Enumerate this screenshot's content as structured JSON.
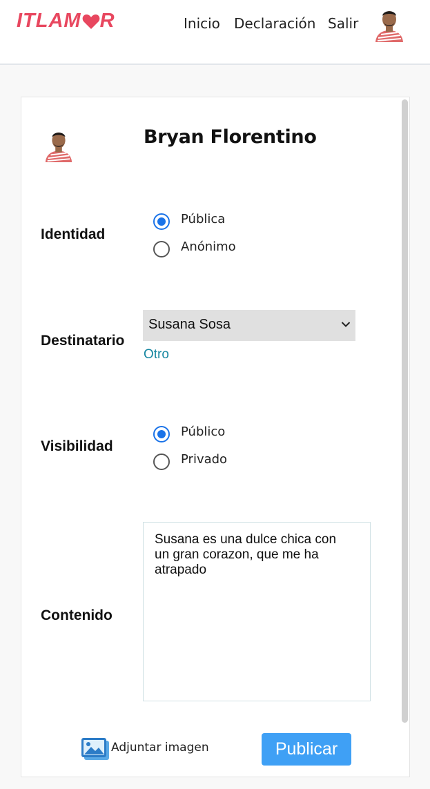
{
  "header": {
    "logo": {
      "left": "ITLAM",
      "right": "R",
      "color": "#e8475f"
    },
    "nav": [
      {
        "label": "Inicio"
      },
      {
        "label": "Declaración"
      },
      {
        "label": "Salir"
      }
    ]
  },
  "profile": {
    "name": "Bryan Florentino"
  },
  "form": {
    "identidad": {
      "label": "Identidad",
      "options": [
        {
          "label": "Pública",
          "checked": true
        },
        {
          "label": "Anónimo",
          "checked": false
        }
      ]
    },
    "destinatario": {
      "label": "Destinatario",
      "selected": "Susana Sosa",
      "other_link": "Otro"
    },
    "visibilidad": {
      "label": "Visibilidad",
      "options": [
        {
          "label": "Público",
          "checked": true
        },
        {
          "label": "Privado",
          "checked": false
        }
      ]
    },
    "contenido": {
      "label": "Contenido",
      "value": "Susana es una dulce chica con\nun gran corazon, que me ha\natrapado"
    },
    "attach_label": "Adjuntar imagen",
    "submit_label": "Publicar"
  },
  "colors": {
    "accent": "#1a73e8",
    "button": "#3fa0f5",
    "link": "#1787a1"
  }
}
